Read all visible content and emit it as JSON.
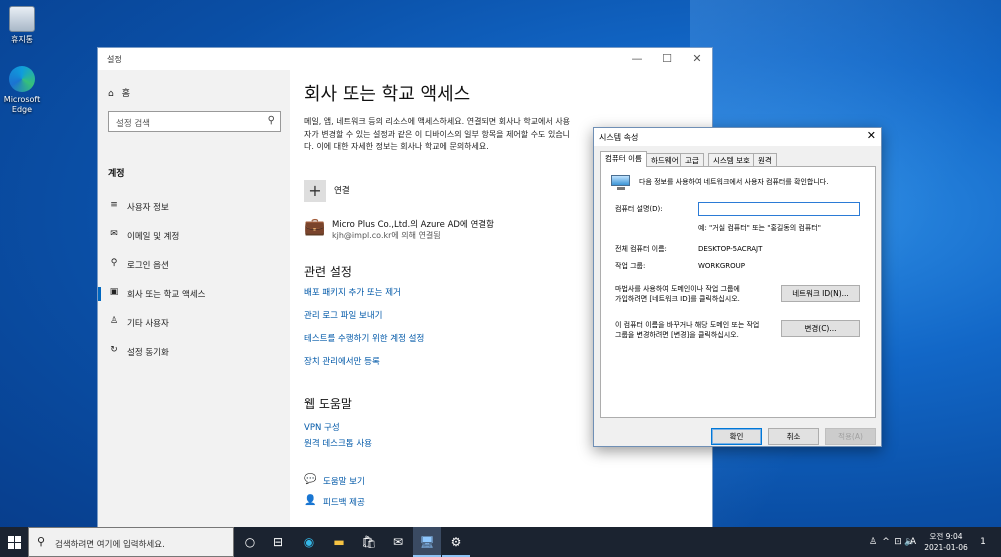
{
  "desktop": {
    "icons": [
      {
        "label": "휴지통",
        "icon": "recycle-bin-icon"
      },
      {
        "label": "Microsoft Edge",
        "icon": "edge-icon"
      }
    ]
  },
  "settings": {
    "window_title": "설정",
    "controls": {
      "minimize": "—",
      "maximize": "☐",
      "close": "✕"
    },
    "sidebar": {
      "home": "홈",
      "search_placeholder": "설정 검색",
      "category": "계정",
      "items": [
        {
          "label": "사용자 정보",
          "icon": "user-info-icon",
          "glyph": "≡"
        },
        {
          "label": "이메일 및 계정",
          "icon": "mail-icon",
          "glyph": "✉"
        },
        {
          "label": "로그인 옵션",
          "icon": "key-icon",
          "glyph": "⚲"
        },
        {
          "label": "회사 또는 학교 액세스",
          "icon": "briefcase-icon",
          "glyph": "▣"
        },
        {
          "label": "기타 사용자",
          "icon": "person-icon",
          "glyph": "♙"
        },
        {
          "label": "설정 동기화",
          "icon": "sync-icon",
          "glyph": "↻"
        }
      ]
    },
    "main": {
      "title": "회사 또는 학교 액세스",
      "description": "메일, 앱, 네트워크 등의 리소스에 액세스하세요. 연결되면 회사나 학교에서 사용자가 변경할 수 있는 설정과 같은 이 디바이스의 일부 항목을 제어할 수도 있습니다. 이에 대한 자세한 정보는 회사나 학교에 문의하세요.",
      "connect_label": "연결",
      "account": {
        "title": "Micro Plus Co.,Ltd.의 Azure AD에 연결함",
        "subtitle": "kjh@impl.co.kr에 의해 연결됨"
      },
      "related_heading": "관련 설정",
      "related_links": [
        "배포 패키지 추가 또는 제거",
        "관리 로그 파일 보내기",
        "테스트를 수행하기 위한 계정 설정",
        "장치 관리에서만 등록"
      ],
      "web_help_heading": "웹 도움말",
      "web_help_links": [
        "VPN 구성",
        "원격 데스크톱 사용"
      ],
      "help": [
        {
          "label": "도움말 보기",
          "icon": "help-chat-icon"
        },
        {
          "label": "피드백 제공",
          "icon": "feedback-icon"
        }
      ]
    }
  },
  "system_properties": {
    "title": "시스템 속성",
    "tabs": [
      "컴퓨터 이름",
      "하드웨어",
      "고급",
      "시스템 보호",
      "원격"
    ],
    "intro": "다음 정보를 사용하여 네트워크에서 사용자 컴퓨터를 확인합니다.",
    "description_label": "컴퓨터 설명(D):",
    "description_value": "",
    "example": "예: \"거실 컴퓨터\" 또는 \"홍길동의 컴퓨터\"",
    "full_name_label": "전체 컴퓨터 이름:",
    "full_name_value": "DESKTOP-5ACRAJT",
    "workgroup_label": "작업 그룹:",
    "workgroup_value": "WORKGROUP",
    "network_id_text1": "마법사를 사용하여 도메인이나 작업 그룹에",
    "network_id_text2": "가입하려면 [네트워크 ID]를 클릭하십시오.",
    "network_id_button": "네트워크 ID(N)...",
    "change_text1": "이 컴퓨터 이름을 바꾸거나 해당 도메인 또는 작업",
    "change_text2": "그룹을 변경하려면 [변경]을 클릭하십시오.",
    "change_button": "변경(C)...",
    "ok_button": "확인",
    "cancel_button": "취소",
    "apply_button": "적용(A)"
  },
  "taskbar": {
    "search_placeholder": "검색하려면 여기에 입력하세요.",
    "time": "오전 9:04",
    "date": "2021-01-06",
    "ime": "A",
    "notification_count": "1"
  }
}
